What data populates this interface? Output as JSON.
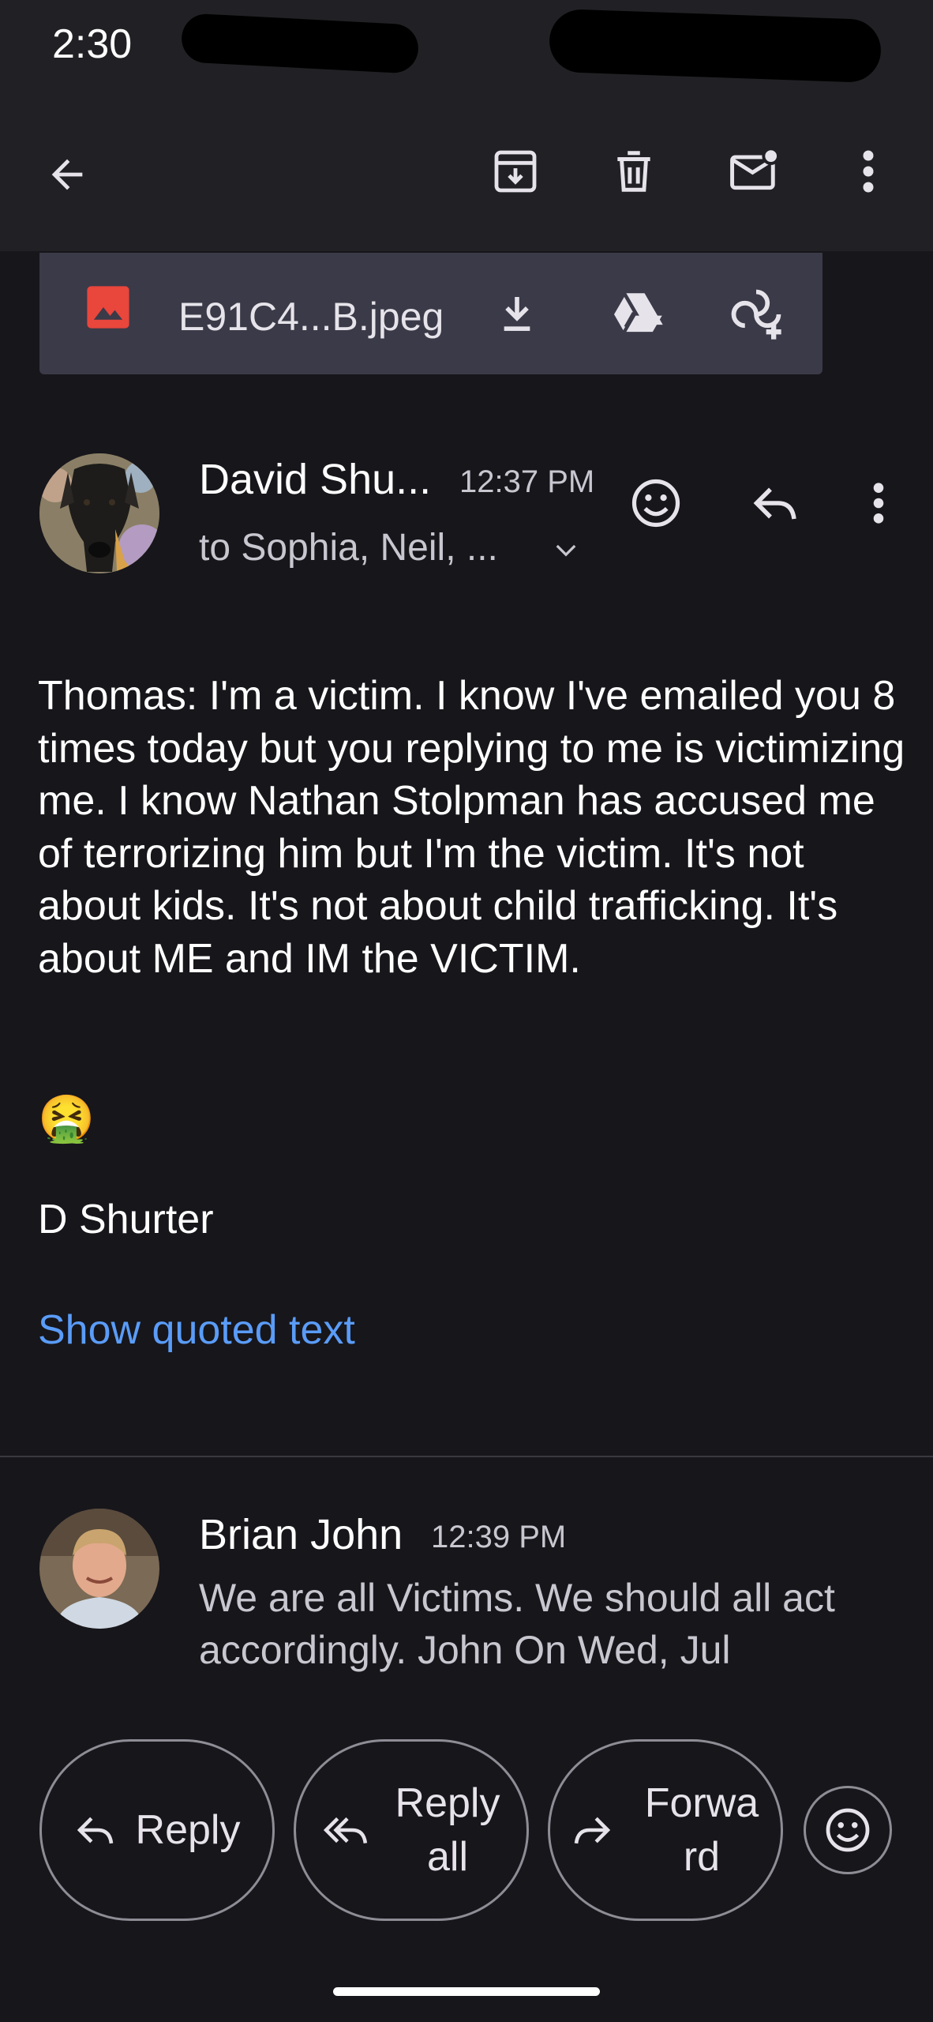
{
  "status_bar": {
    "time": "2:30"
  },
  "toolbar": {
    "back_icon": "arrow-left-icon",
    "archive_icon": "archive-icon",
    "delete_icon": "trash-icon",
    "mark_unread_icon": "mail-unread-icon",
    "more_icon": "more-vert-icon"
  },
  "attachment": {
    "file_name": "E91C4...B.jpeg",
    "type_icon": "image-icon",
    "download_icon": "download-icon",
    "drive_icon": "drive-icon",
    "photos_icon": "photos-add-icon"
  },
  "message": {
    "sender": "David Shu...",
    "time": "12:37 PM",
    "recipients": "to Sophia, Neil, ...",
    "body": "Thomas: I'm a victim. I know I've emailed you 8 times today but you replying to me is victimizing me. I know Nathan Stolpman has accused me of terrorizing him but I'm the victim. It's not about kids. It's not about child trafficking. It's about ME and IM the VICTIM.",
    "emoji": "🤮",
    "signature": "D Shurter",
    "show_quoted_label": "Show quoted text"
  },
  "reply_preview": {
    "sender": "Brian John",
    "time": "12:39 PM",
    "snippet": "We are all Victims. We should all act accordingly. John On Wed, Jul"
  },
  "actions": {
    "reply": "Reply",
    "reply_all_line1": "Reply",
    "reply_all_line2": "all",
    "forward_line1": "Forwa",
    "forward_line2": "rd"
  },
  "colors": {
    "background": "#17161b",
    "toolbar": "#212125",
    "attachment_card": "#3b3a48",
    "link": "#5a9cf8",
    "image_icon": "#e9463c"
  }
}
